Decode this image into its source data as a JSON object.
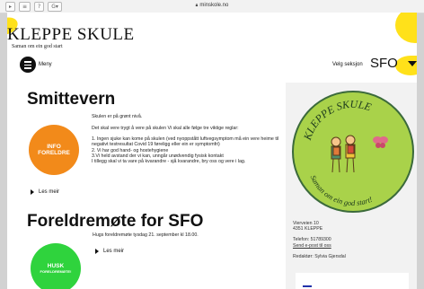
{
  "browser": {
    "buttons": [
      "▸",
      "≡",
      "?",
      "G▾"
    ],
    "url": "minskole.no"
  },
  "header": {
    "title": "KLEPPE SKULE",
    "tagline": "Saman om ein god start",
    "menu_label": "Meny",
    "section_label": "Velg seksjon",
    "section_value": "SFO"
  },
  "posts": [
    {
      "title": "Smittevern",
      "badge": [
        "INFO",
        "FORELDRE"
      ],
      "text": "Skulen er på grønt nivå.\n\nDet skal vere trygt å vere på skulen Vi skal alle følge tre viktige reglar:\n\n1. Ingen sjuke kan kome på skulen (ved nyoppstått luftvegsymptom må ein vere heime til negativt testresultat Covid 19 føreligg eller ein er symptomfri)\n2. Vi har god hand- og hostehygiene\n3.Vi held avstand der vi kan, unngår unødvendig fysisk kontakt\nI tillegg skal vi ta vare på kvarandre - sjå kvarandre, bry oss og vere i lag.",
      "read_more": "Les meir"
    },
    {
      "title": "Foreldremøte for SFO",
      "badge": [
        "HUSK",
        "FORELDREMØTE!"
      ],
      "text": "Hugs foreldremøte tysdag 21. september kl 18.00.",
      "read_more": "Les meir"
    }
  ],
  "logo": {
    "arc_text": "KLEPPE SKULE",
    "slogan": "Saman om ein god start!",
    "bg_color": "#a9d24a",
    "ring_color": "#3b6a3b"
  },
  "contact": {
    "address1": "Vierveien 10",
    "address2": "4351 KLEPPE",
    "phone": "Telefon: 51789300",
    "email_link": "Send e-post til oss",
    "editor": "Redaktør: Sylvia Gjersdal"
  },
  "colors": {
    "badge_orange": "#f28a1a",
    "badge_green": "#2fd33d",
    "accent_yellow": "#ffe11a"
  }
}
